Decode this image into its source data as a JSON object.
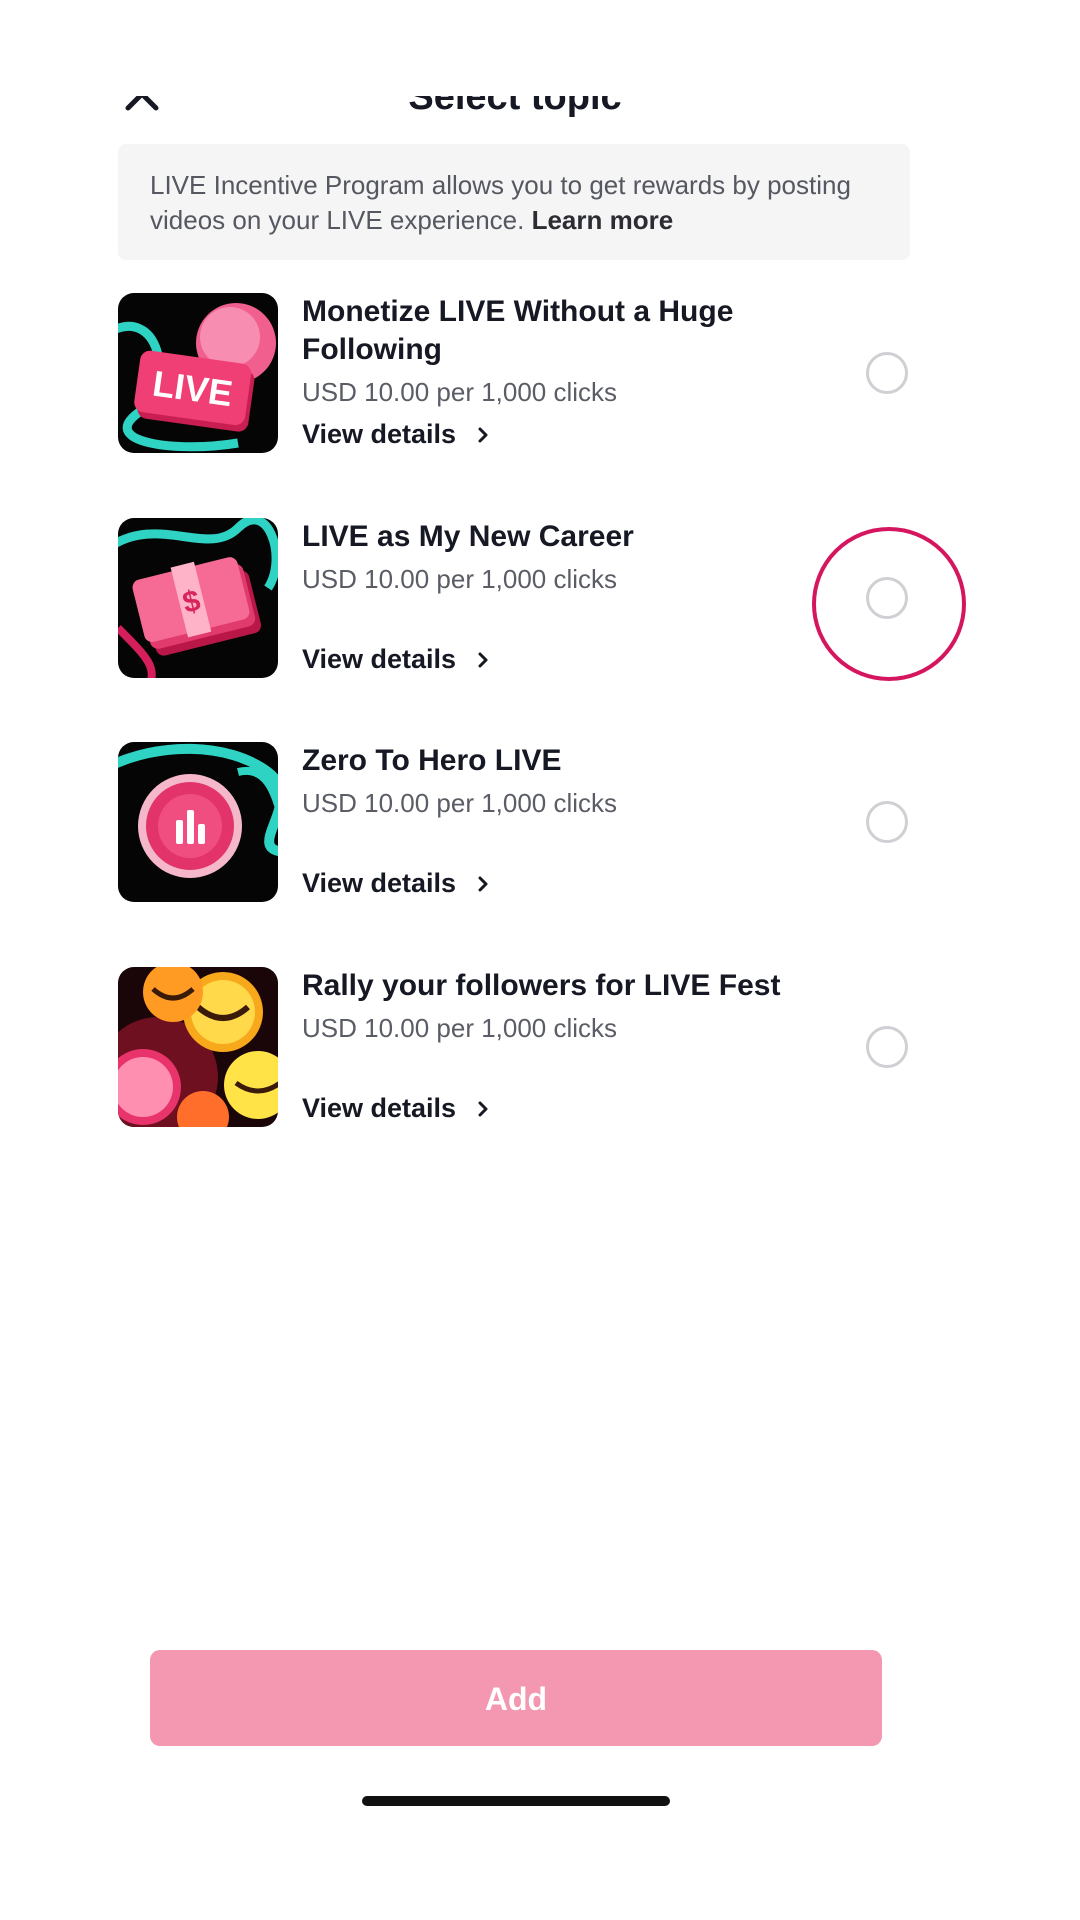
{
  "header": {
    "title": "Select topic"
  },
  "info": {
    "text": "LIVE Incentive Program allows you to get rewards by posting videos on your LIVE experience.",
    "link": "Learn more"
  },
  "topics": [
    {
      "title": "Monetize LIVE Without a Huge Following",
      "price": "USD 10.00 per 1,000 clicks",
      "details_label": "View details",
      "thumb_text": "LIVE",
      "selected": false
    },
    {
      "title": "LIVE as My New Career",
      "price": "USD 10.00 per 1,000 clicks",
      "details_label": "View details",
      "thumb_text": "$",
      "selected": false
    },
    {
      "title": "Zero To Hero LIVE",
      "price": "USD 10.00 per 1,000 clicks",
      "details_label": "View details",
      "selected": false
    },
    {
      "title": "Rally your followers for LIVE Fest",
      "price": "USD 10.00 per 1,000 clicks",
      "details_label": "View details",
      "selected": false
    }
  ],
  "footer": {
    "add_label": "Add"
  },
  "colors": {
    "accent": "#f398b0",
    "highlight": "#d5165f",
    "radio_border": "#cfd0d4"
  },
  "icons": {
    "close": "close-icon",
    "chevron": "chevron-right-icon"
  }
}
